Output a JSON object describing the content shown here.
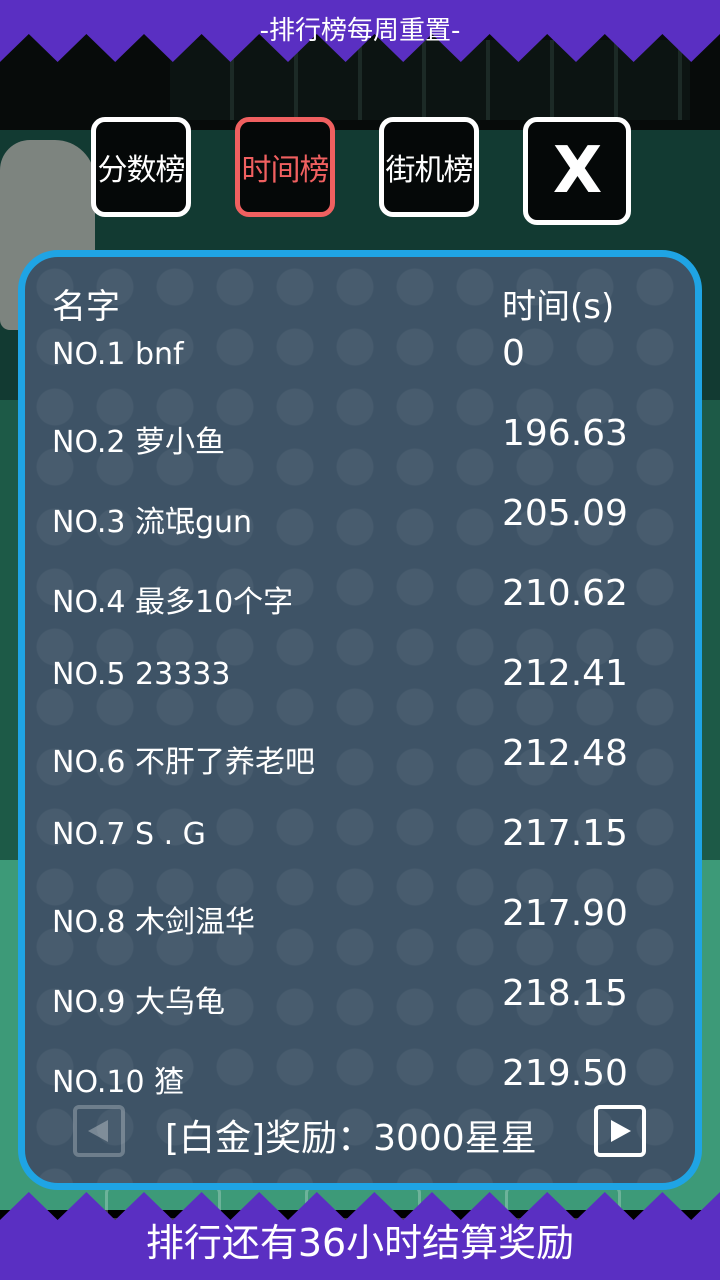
{
  "top_banner": {
    "text": "-排行榜每周重置-"
  },
  "tabs": [
    {
      "label": "分数榜",
      "active": false
    },
    {
      "label": "时间榜",
      "active": true
    },
    {
      "label": "街机榜",
      "active": false
    },
    {
      "label": "X",
      "icon": "close-icon"
    }
  ],
  "table": {
    "headers": {
      "name": "名字",
      "time": "时间(s)"
    },
    "rows": [
      {
        "name": "NO.1 bnf",
        "time": "0"
      },
      {
        "name": "NO.2 萝小鱼",
        "time": "196.63"
      },
      {
        "name": "NO.3 流氓gun",
        "time": "205.09"
      },
      {
        "name": "NO.4 最多10个字",
        "time": "210.62"
      },
      {
        "name": "NO.5 23333",
        "time": "212.41"
      },
      {
        "name": "NO.6 不肝了养老吧",
        "time": "212.48"
      },
      {
        "name": "NO.7 S . G",
        "time": "217.15"
      },
      {
        "name": "NO.8 木剑温华",
        "time": "217.90"
      },
      {
        "name": "NO.9 大乌龟",
        "time": "218.15"
      },
      {
        "name": "NO.10 猹",
        "time": "219.50"
      }
    ]
  },
  "footer": {
    "reward_text": "[白金]奖励：3000星星",
    "prev_icon": "arrow-left-icon",
    "next_icon": "arrow-right-icon"
  },
  "bottom_banner": {
    "text": "排行还有36小时结算奖励"
  },
  "colors": {
    "accent": "#1fa4e4",
    "active_tab": "#f06060",
    "banner": "#5a2fc2",
    "panel": "#3e5366"
  }
}
